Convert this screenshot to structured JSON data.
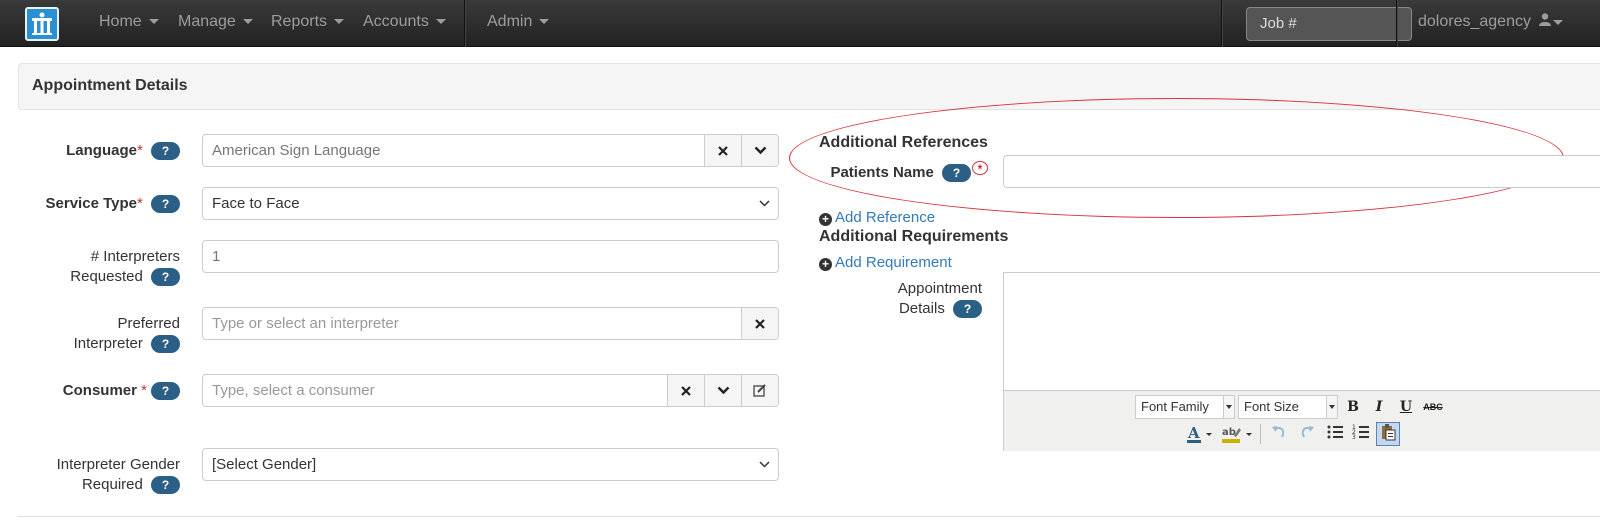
{
  "navbar": {
    "menu": [
      {
        "label": "Home"
      },
      {
        "label": "Manage"
      },
      {
        "label": "Reports"
      },
      {
        "label": "Accounts"
      },
      {
        "label": "Admin"
      }
    ],
    "job_placeholder": "Job #",
    "user": "dolores_agency",
    "icons": {
      "logo": "app-logo-icon",
      "user": "user-icon"
    }
  },
  "panel": {
    "title": "Appointment Details"
  },
  "form": {
    "language": {
      "label": "Language",
      "value": "American Sign Language"
    },
    "service_type": {
      "label": "Service Type",
      "value": "Face to Face"
    },
    "interpreters": {
      "label_line1": "# Interpreters",
      "label_line2": "Requested",
      "value": "1"
    },
    "preferred": {
      "label_line1": "Preferred",
      "label_line2": "Interpreter",
      "placeholder": "Type or select an interpreter"
    },
    "consumer": {
      "label": "Consumer",
      "placeholder": "Type, select a consumer"
    },
    "gender": {
      "label_line1": "Interpreter Gender",
      "label_line2": "Required",
      "value": "[Select Gender]"
    },
    "required_mark": "*",
    "help_text": "?"
  },
  "right": {
    "additional_references": "Additional References",
    "patients_name_label": "Patients Name",
    "add_reference": "Add Reference",
    "additional_requirements": "Additional Requirements",
    "add_requirement": "Add Requirement",
    "appointment_details_line1": "Appointment",
    "appointment_details_line2": "Details"
  },
  "editor": {
    "font_family": "Font Family",
    "font_size": "Font Size",
    "buttons": {
      "bold": "B",
      "italic": "I",
      "underline": "U",
      "strike": "ABC"
    }
  },
  "colors": {
    "accent": "#337ab7",
    "help_badge": "#2c5f85",
    "annotation": "#d9333a",
    "required": "#c9302c"
  }
}
